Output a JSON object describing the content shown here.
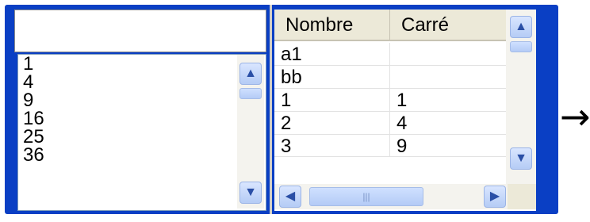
{
  "left_list": {
    "items": [
      "1",
      "4",
      "9",
      "16",
      "25",
      "36"
    ]
  },
  "grid": {
    "headers": [
      "Nombre",
      "Carré"
    ],
    "rows": [
      [
        "a1",
        ""
      ],
      [
        "bb",
        ""
      ],
      [
        "1",
        "1"
      ],
      [
        "2",
        "4"
      ],
      [
        "3",
        "9"
      ]
    ]
  },
  "icons": {
    "up": "▲",
    "down": "▼",
    "left": "◀",
    "right": "▶",
    "grip": "|||",
    "arrow": "→"
  }
}
